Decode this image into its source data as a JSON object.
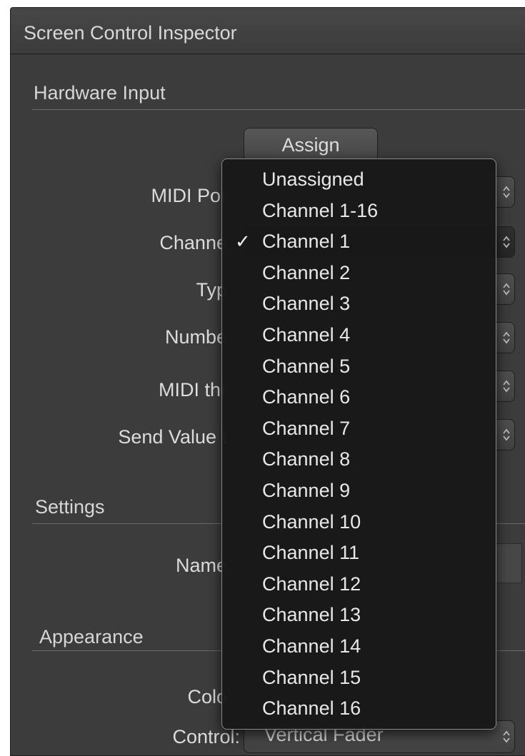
{
  "panel": {
    "title": "Screen Control Inspector"
  },
  "hardware_input": {
    "section_title": "Hardware Input",
    "assign_label": "Assign",
    "fields": {
      "midi_port": "MIDI Por",
      "channel": "Channe",
      "type": "Typ",
      "number": "Numbe",
      "midi_thru": "MIDI thr",
      "send_value_to": "Send Value t"
    }
  },
  "settings": {
    "section_title": "Settings",
    "name_label": "Name"
  },
  "appearance": {
    "section_title": "Appearance",
    "color_label": "Colo",
    "control_label": "Control:",
    "control_value": "Vertical Fader"
  },
  "channel_menu": {
    "selected": "Channel 1",
    "check_glyph": "✓",
    "items": [
      "Unassigned",
      "Channel 1-16",
      "Channel 1",
      "Channel 2",
      "Channel 3",
      "Channel 4",
      "Channel 5",
      "Channel 6",
      "Channel 7",
      "Channel 8",
      "Channel 9",
      "Channel 10",
      "Channel 11",
      "Channel 12",
      "Channel 13",
      "Channel 14",
      "Channel 15",
      "Channel 16"
    ]
  },
  "icons": {
    "popup_stepper": "up-down-chevron-icon",
    "checkmark": "checkmark-icon"
  },
  "colors": {
    "panel_bg": "#3c3c3c",
    "menu_bg": "#181818",
    "text": "#dcdcdc",
    "menu_border": "#8a8a8a"
  }
}
